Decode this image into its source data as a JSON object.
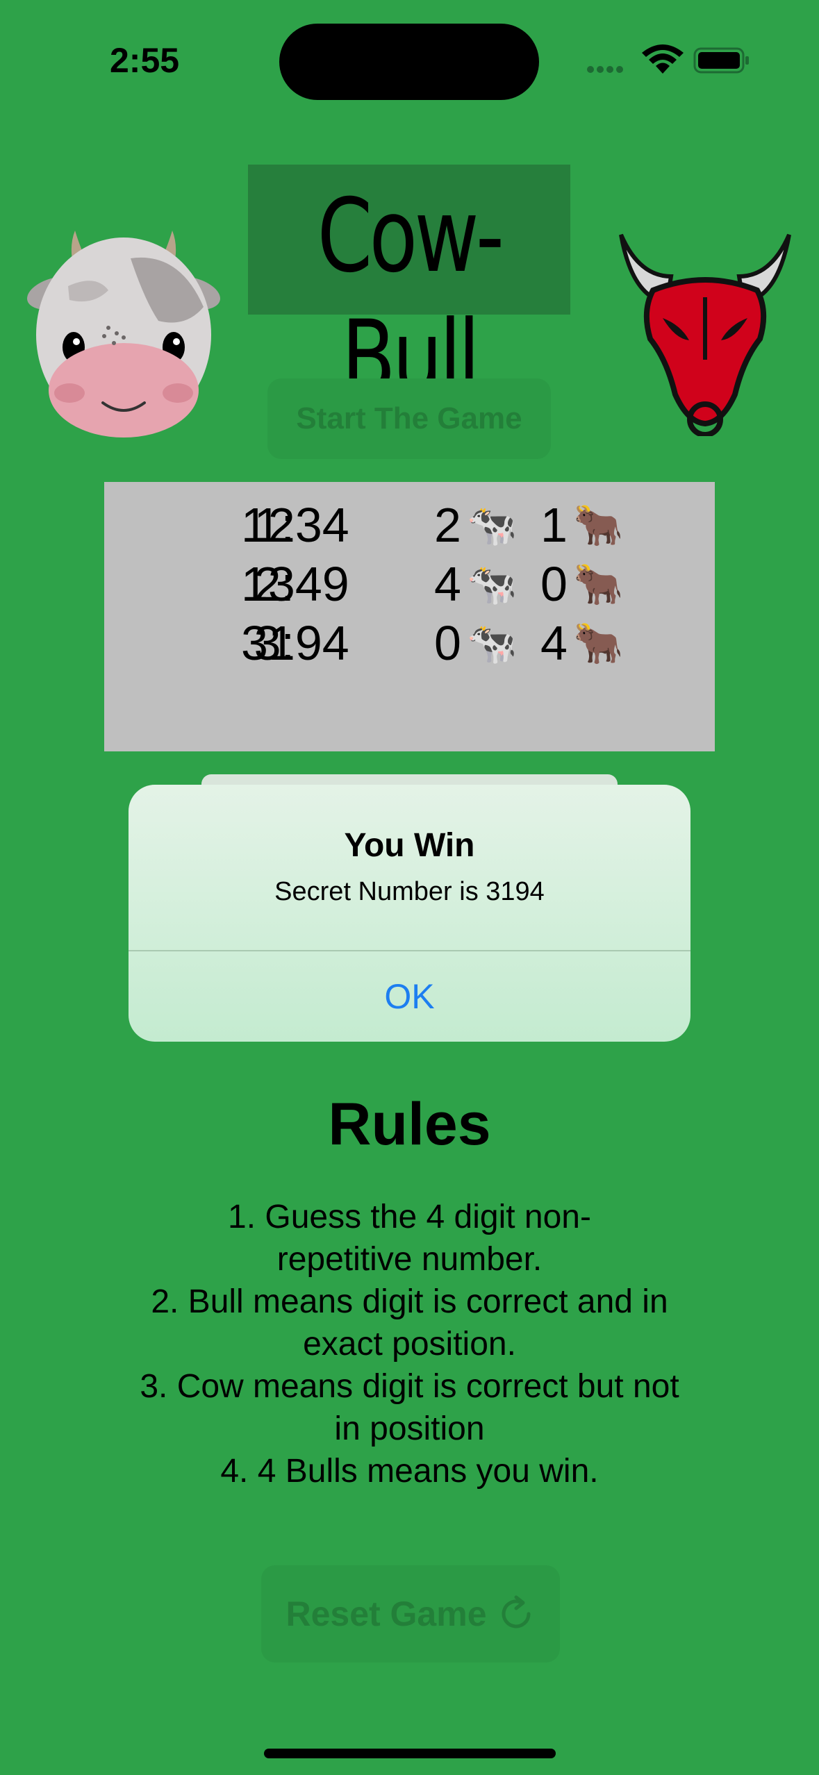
{
  "status_bar": {
    "time": "2:55"
  },
  "header": {
    "title": "Cow-Bull"
  },
  "controls": {
    "start_label": "Start The Game",
    "reset_label": "Reset Game"
  },
  "guesses": [
    {
      "index": "1:",
      "number": "1234",
      "cows": "2",
      "bulls": "1"
    },
    {
      "index": "2:",
      "number": "1349",
      "cows": "4",
      "bulls": "0"
    },
    {
      "index": "3:",
      "number": "3194",
      "cows": "0",
      "bulls": "4"
    }
  ],
  "emojis": {
    "cow": "🐄",
    "bull": "🐂"
  },
  "alert": {
    "title": "You Win",
    "message": "Secret Number is 3194",
    "ok_label": "OK"
  },
  "rules": {
    "title": "Rules",
    "lines": [
      "1. Guess the 4 digit non-",
      "repetitive number.",
      "2. Bull means digit is correct and in",
      "exact position.",
      "3. Cow means digit is correct but not",
      "in position",
      "4. 4 Bulls means you win."
    ]
  },
  "colors": {
    "background": "#2ea249",
    "alert_button": "#1d7ef0",
    "bull_red": "#d0021b"
  },
  "icons": [
    "signal-icon",
    "wifi-icon",
    "battery-icon",
    "refresh-icon"
  ]
}
